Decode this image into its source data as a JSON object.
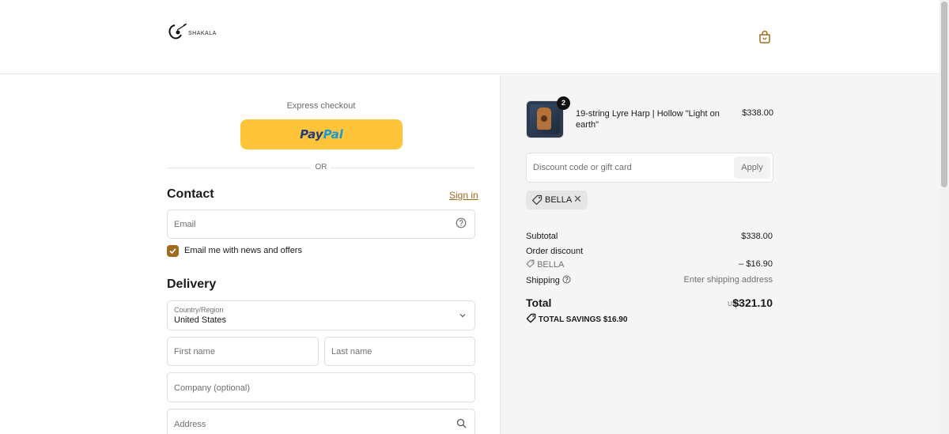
{
  "header": {
    "logo_text": "SHAKALA",
    "cart_icon": "shopping-bag-icon"
  },
  "checkout": {
    "express_label": "Express checkout",
    "paypal_part1": "Pay",
    "paypal_part2": "Pal",
    "or_label": "OR",
    "contact_title": "Contact",
    "signin_label": "Sign in",
    "email_placeholder": "Email",
    "email_help_icon": "question-circle-icon",
    "newsletter_label": "Email me with news and offers",
    "newsletter_checked": true,
    "delivery_title": "Delivery",
    "country_label": "Country/Region",
    "country_value": "United States",
    "first_name_placeholder": "First name",
    "last_name_placeholder": "Last name",
    "company_placeholder": "Company (optional)",
    "address_placeholder": "Address"
  },
  "summary": {
    "product": {
      "name": "19-string Lyre Harp | Hollow \"Light on earth\"",
      "price": "$338.00",
      "quantity": "2"
    },
    "discount_placeholder": "Discount code or gift card",
    "apply_label": "Apply",
    "applied_code": "BELLA",
    "subtotal_label": "Subtotal",
    "subtotal_value": "$338.00",
    "order_discount_label": "Order discount",
    "discount_code_label": "BELLA",
    "discount_value": "– $16.90",
    "shipping_label": "Shipping",
    "shipping_value": "Enter shipping address",
    "total_label": "Total",
    "currency": "USD",
    "total_value": "$321.10",
    "savings_label": "TOTAL SAVINGS",
    "savings_value": "$16.90"
  },
  "colors": {
    "accent": "#a06b1d",
    "paypal_yellow": "#ffc439",
    "summary_bg": "#f5f5f5"
  }
}
